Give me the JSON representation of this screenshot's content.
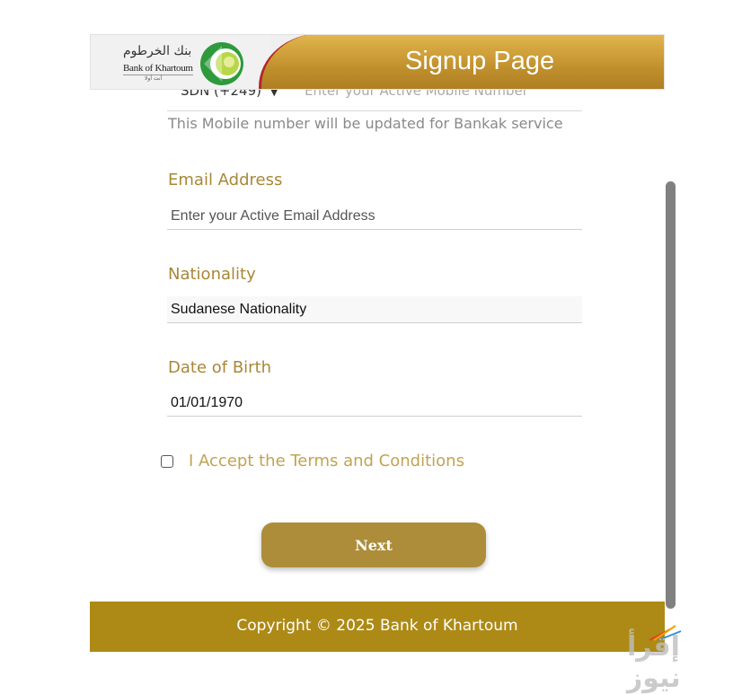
{
  "header": {
    "title": "Signup Page",
    "logo_arabic": "بنك الخرطوم",
    "logo_english": "Bank of Khartoum",
    "logo_sub": "أنت أولا"
  },
  "mobile": {
    "country_code": "SDN (+249)",
    "placeholder": "Enter your Active Mobile Number",
    "hint": "This Mobile number will be updated for Bankak service"
  },
  "email": {
    "label": "Email Address",
    "placeholder": "Enter your Active Email Address"
  },
  "nationality": {
    "label": "Nationality",
    "value": "Sudanese Nationality"
  },
  "dob": {
    "label": "Date of Birth",
    "value": "01/01/1970"
  },
  "terms": {
    "label": "I Accept the Terms and Conditions",
    "checked": false
  },
  "next_button": "Next",
  "footer": {
    "copyright": "Copyright © 2025 Bank of Khartoum"
  },
  "watermark": "إقرأ نيوز",
  "colors": {
    "gold_accent": "#ad8d3a",
    "label_gold": "#a88838",
    "footer_gold": "#ad8a15",
    "header_red_edge": "#b3262a",
    "logo_green": "#2e9a3c"
  }
}
